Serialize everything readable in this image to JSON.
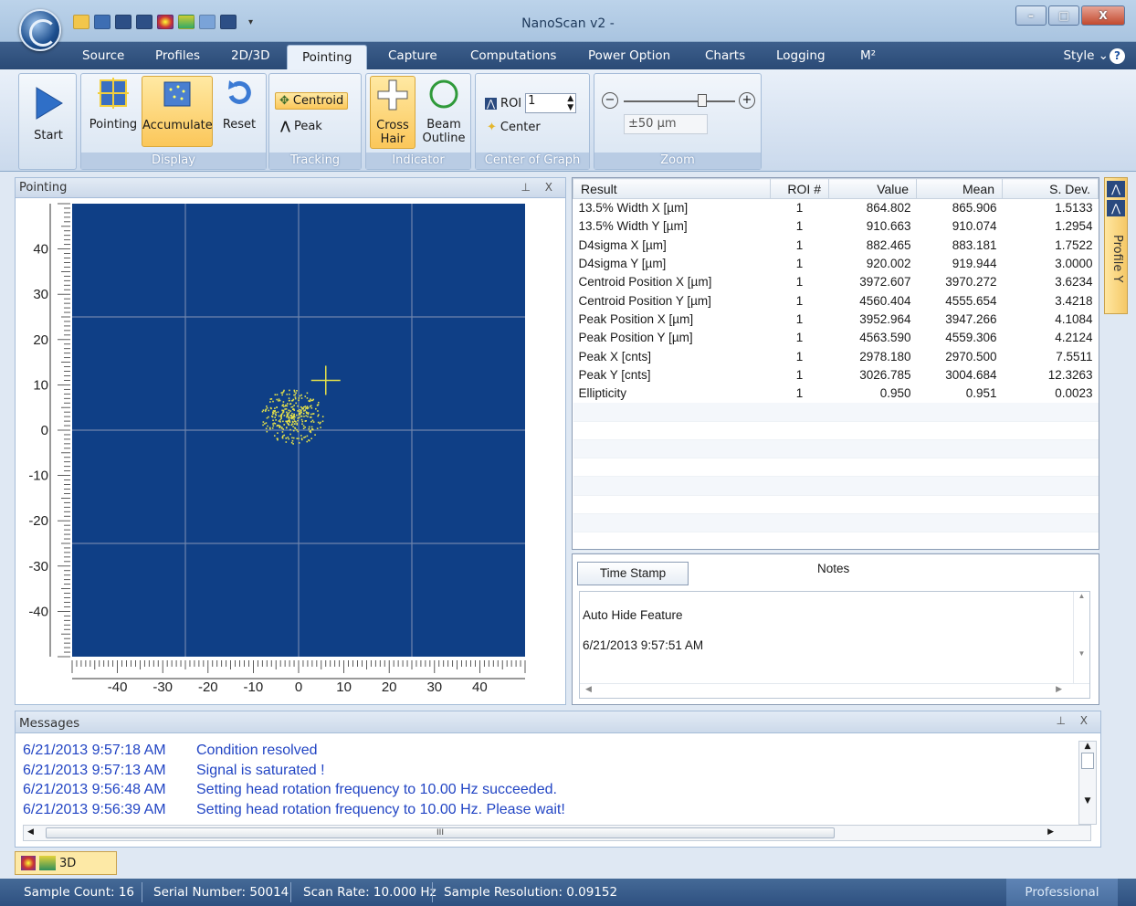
{
  "window": {
    "title": "NanoScan v2 -",
    "minimize": "–",
    "maximize": "□",
    "close": "X"
  },
  "qat": {
    "dropdown": "▾"
  },
  "tabs": [
    "Source",
    "Profiles",
    "2D/3D",
    "Pointing",
    "Capture",
    "Computations",
    "Power Option",
    "Charts",
    "Logging",
    "M²"
  ],
  "style_label": "Style ⌄",
  "help": "?",
  "ribbon": {
    "start": "Start",
    "display": {
      "pointing": "Pointing",
      "accumulate": "Accumulate",
      "reset": "Reset",
      "label": "Display"
    },
    "tracking": {
      "centroid": "Centroid",
      "peak": "Peak",
      "label": "Tracking"
    },
    "indicator": {
      "crosshair_line1": "Cross",
      "crosshair_line2": "Hair",
      "beam_line1": "Beam",
      "beam_line2": "Outline",
      "label": "Indicator"
    },
    "center_of_graph": {
      "roi": "ROI",
      "roi_value": "1",
      "center": "Center",
      "label": "Center of Graph"
    },
    "zoom": {
      "value": "±50 μm",
      "label": "Zoom",
      "level": 0.72
    }
  },
  "pointing_panel": {
    "title": "Pointing",
    "pin": "⊥",
    "close": "X"
  },
  "plot": {
    "x_ticks": [
      "-40",
      "-30",
      "-20",
      "-10",
      "0",
      "10",
      "20",
      "30",
      "40"
    ],
    "y_ticks": [
      "40",
      "30",
      "20",
      "10",
      "0",
      "-10",
      "-20",
      "-30",
      "-40"
    ],
    "x_range": [
      -50,
      50
    ],
    "y_range": [
      -50,
      50
    ],
    "crosshair": [
      6,
      11
    ],
    "cluster_center": [
      -1.5,
      3
    ],
    "background": "#0f3f86",
    "grid_color": "#6f84ad",
    "point_color": "#e4e04a"
  },
  "results": {
    "headers": [
      "Result",
      "ROI #",
      "Value",
      "Mean",
      "S. Dev."
    ],
    "rows": [
      [
        "13.5% Width X [µm]",
        "1",
        "864.802",
        "865.906",
        "1.5133"
      ],
      [
        "13.5% Width Y [µm]",
        "1",
        "910.663",
        "910.074",
        "1.2954"
      ],
      [
        "D4sigma X [µm]",
        "1",
        "882.465",
        "883.181",
        "1.7522"
      ],
      [
        "D4sigma Y [µm]",
        "1",
        "920.002",
        "919.944",
        "3.0000"
      ],
      [
        "Centroid Position X [µm]",
        "1",
        "3972.607",
        "3970.272",
        "3.6234"
      ],
      [
        "Centroid Position Y [µm]",
        "1",
        "4560.404",
        "4555.654",
        "3.4218"
      ],
      [
        "Peak Position X [µm]",
        "1",
        "3952.964",
        "3947.266",
        "4.1084"
      ],
      [
        "Peak Position Y [µm]",
        "1",
        "4563.590",
        "4559.306",
        "4.2124"
      ],
      [
        "Peak X [cnts]",
        "1",
        "2978.180",
        "2970.500",
        "7.5511"
      ],
      [
        "Peak Y [cnts]",
        "1",
        "3026.785",
        "3004.684",
        "12.3263"
      ],
      [
        "Ellipticity",
        "1",
        "0.950",
        "0.951",
        "0.0023"
      ]
    ]
  },
  "side_tab": {
    "label": "Profile Y"
  },
  "notes": {
    "timestamp_button": "Time Stamp",
    "title": "Notes",
    "line1": "Auto Hide Feature",
    "line2": "6/21/2013 9:57:51 AM"
  },
  "messages": {
    "title": "Messages",
    "pin": "⊥",
    "close": "X",
    "rows": [
      {
        "time": "6/21/2013 9:57:18 AM",
        "text": "Condition resolved"
      },
      {
        "time": "6/21/2013 9:57:13 AM",
        "text": "Signal is saturated !"
      },
      {
        "time": "6/21/2013 9:56:48 AM",
        "text": "Setting head rotation frequency to 10.00 Hz succeeded."
      },
      {
        "time": "6/21/2013 9:56:39 AM",
        "text": "Setting head rotation frequency to 10.00 Hz. Please wait!"
      }
    ],
    "scroll_thumb": "III"
  },
  "view_tab": {
    "label": "3D"
  },
  "status": {
    "sample_count": "Sample Count: 16",
    "serial_number": "Serial Number: 50014",
    "scan_rate": "Scan Rate: 10.000 Hz",
    "sample_resolution": "Sample Resolution: 0.09152",
    "edition": "Professional"
  }
}
